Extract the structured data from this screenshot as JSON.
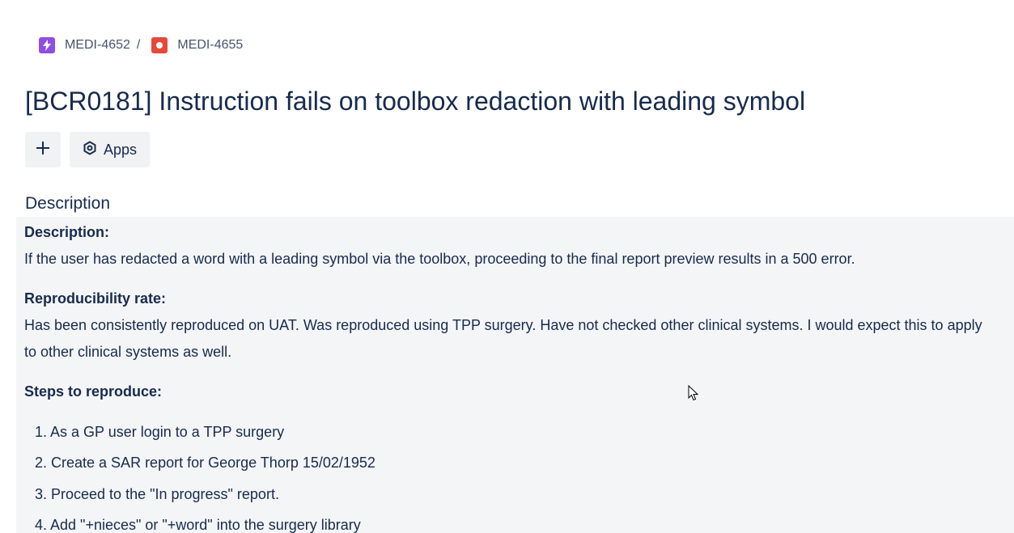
{
  "breadcrumb": {
    "parent": {
      "key": "MEDI-4652",
      "icon": "epic-lightning-icon",
      "color": "#904ee2"
    },
    "separator": "/",
    "current": {
      "key": "MEDI-4655",
      "icon": "bug-icon",
      "color": "#e5493a"
    }
  },
  "issue": {
    "title": "[BCR0181] Instruction fails on toolbox redaction with leading symbol"
  },
  "actions": {
    "add_icon": "plus-icon",
    "apps_icon": "apps-hexagon-icon",
    "apps_label": "Apps"
  },
  "description": {
    "heading": "Description",
    "label_description": "Description:",
    "text_description": "If the user has redacted a word with a leading symbol via the toolbox, proceeding to the final report preview results in a 500 error.",
    "label_repro_rate": "Reproducibility rate:",
    "text_repro_rate": "Has been consistently reproduced on UAT. Was reproduced using TPP surgery. Have not checked other clinical systems. I would expect this to apply to other clinical systems as well.",
    "label_steps": "Steps to reproduce:",
    "steps": [
      "As a GP user login to a TPP surgery",
      "Create a SAR report for George Thorp 15/02/1952",
      "Proceed to the \"In progress\" report.",
      "Add \"+nieces\" or \"+word\" into the surgery library"
    ]
  },
  "colors": {
    "text_primary": "#172b4d",
    "text_subtle": "#44546f",
    "panel_background": "#f4f5f7",
    "button_background": "#f1f2f4"
  }
}
